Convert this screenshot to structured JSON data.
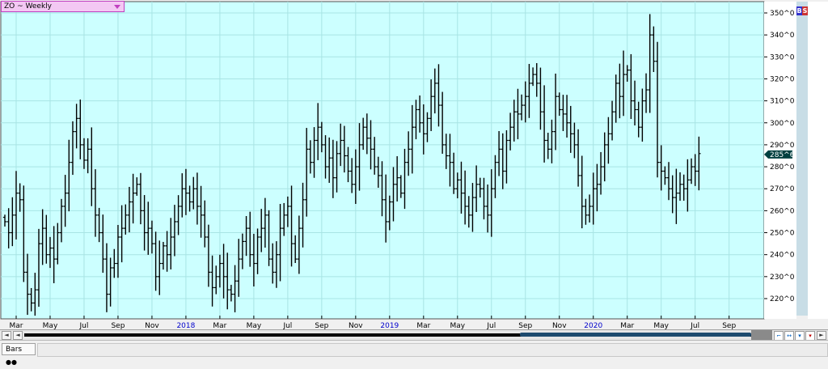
{
  "symbol": {
    "label": "ZO ~ Weekly"
  },
  "indicators": {
    "b": "B",
    "s": "S"
  },
  "last_price_label": "285^6",
  "status_bar": {
    "tab_label": "Bars",
    "tab_icon": "chain-links-icon"
  },
  "scrollbar": {
    "left_arrow_1": "◄",
    "left_arrow_2": "◄",
    "right_arrow": "►"
  },
  "colors": {
    "plot_bg": "#ccffff",
    "grid": "#a8e4e4",
    "bar": "#000000",
    "axis_text": "#000000",
    "year_text": "#0000cc",
    "price_axis_bg": "#ffffff",
    "price_highlight_bg": "#004040",
    "b_badge": "#3333cc",
    "s_badge": "#cc3333"
  },
  "chart_data": {
    "type": "bar",
    "style": "ohlc",
    "title": "ZO ~ Weekly",
    "ylim": [
      213,
      354
    ],
    "y_ticks": [
      220,
      230,
      240,
      250,
      260,
      270,
      280,
      290,
      300,
      310,
      320,
      330,
      340,
      350
    ],
    "y_tick_labels": [
      "220^0",
      "230^0",
      "240^0",
      "250^0",
      "260^0",
      "270^0",
      "280^0",
      "290^0",
      "300^0",
      "310^0",
      "320^0",
      "330^0",
      "340^0",
      "350^0"
    ],
    "last_value": 285.6,
    "grid": true,
    "x_ticks": [
      {
        "label": "Mar",
        "w": 3
      },
      {
        "label": "May",
        "w": 12
      },
      {
        "label": "Jul",
        "w": 21
      },
      {
        "label": "Sep",
        "w": 30
      },
      {
        "label": "Nov",
        "w": 39
      },
      {
        "label": "2018",
        "w": 48,
        "year": true
      },
      {
        "label": "Mar",
        "w": 57
      },
      {
        "label": "May",
        "w": 66
      },
      {
        "label": "Jul",
        "w": 75
      },
      {
        "label": "Sep",
        "w": 84
      },
      {
        "label": "Nov",
        "w": 93
      },
      {
        "label": "2019",
        "w": 102,
        "year": true
      },
      {
        "label": "Mar",
        "w": 111
      },
      {
        "label": "May",
        "w": 120
      },
      {
        "label": "Jul",
        "w": 129
      },
      {
        "label": "Sep",
        "w": 138
      },
      {
        "label": "Nov",
        "w": 147
      },
      {
        "label": "2020",
        "w": 156,
        "year": true
      },
      {
        "label": "Mar",
        "w": 165
      },
      {
        "label": "May",
        "w": 174
      },
      {
        "label": "Jul",
        "w": 183
      },
      {
        "label": "Sep",
        "w": 192
      }
    ],
    "closes": [
      255,
      250,
      258,
      268,
      265,
      232,
      222,
      218,
      224,
      245,
      252,
      240,
      243,
      238,
      250,
      262,
      268,
      282,
      296,
      302,
      290,
      283,
      288,
      270,
      258,
      250,
      238,
      222,
      234,
      236,
      248,
      252,
      258,
      264,
      268,
      272,
      260,
      250,
      252,
      245,
      230,
      236,
      244,
      240,
      248,
      255,
      262,
      270,
      268,
      264,
      270,
      262,
      258,
      248,
      232,
      225,
      230,
      236,
      230,
      224,
      222,
      228,
      238,
      246,
      252,
      240,
      236,
      248,
      252,
      258,
      238,
      232,
      240,
      252,
      258,
      262,
      245,
      238,
      252,
      265,
      288,
      282,
      292,
      298,
      290,
      280,
      284,
      275,
      286,
      292,
      285,
      278,
      272,
      280,
      290,
      298,
      293,
      288,
      280,
      276,
      265,
      255,
      264,
      272,
      275,
      268,
      282,
      288,
      298,
      306,
      300,
      295,
      302,
      312,
      318,
      308,
      290,
      285,
      282,
      270,
      274,
      268,
      262,
      258,
      266,
      272,
      270,
      262,
      258,
      270,
      282,
      288,
      278,
      292,
      298,
      305,
      304,
      308,
      312,
      318,
      322,
      318,
      305,
      292,
      288,
      296,
      312,
      306,
      304,
      300,
      295,
      290,
      276,
      262,
      258,
      262,
      270,
      272,
      280,
      290,
      295,
      305,
      318,
      312,
      322,
      324,
      310,
      306,
      298,
      310,
      315,
      340,
      328,
      282,
      278,
      275,
      270,
      266,
      268,
      272,
      270,
      274,
      280,
      278,
      286
    ]
  }
}
